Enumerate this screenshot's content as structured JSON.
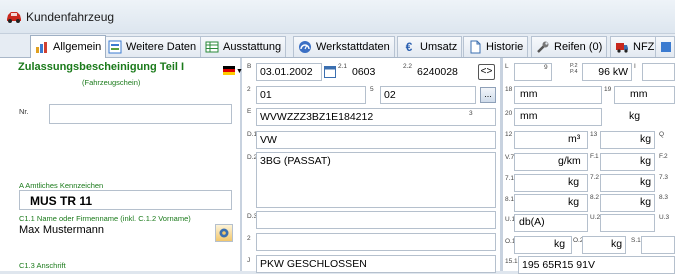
{
  "window": {
    "title": "Kundenfahrzeug"
  },
  "tabs": [
    {
      "label": "Allgemein"
    },
    {
      "label": "Weitere Daten"
    },
    {
      "label": "Ausstattung"
    },
    {
      "label": "Werkstattdaten"
    },
    {
      "label": "Umsatz"
    },
    {
      "label": "Historie"
    },
    {
      "label": "Reifen (0)"
    },
    {
      "label": "NFZ"
    }
  ],
  "left": {
    "heading": "Zulassungsbescheinigung Teil I",
    "subheading": "(Fahrzeugschein)",
    "nr_label": "Nr.",
    "nr_value": "",
    "kennzeichen_label": "A Amtliches Kennzeichen",
    "kennzeichen_value": "MUS TR 11",
    "name_label": "C1.1 Name oder Firmenname (inkl. C.1.2 Vorname)",
    "name_value": "Max Mustermann",
    "anschrift_label": "C1.3 Anschrift"
  },
  "mid": {
    "b_label": "B",
    "b_date": "03.01.2002",
    "code21_label": "2.1",
    "code21": "0603",
    "code22_label": "2.2",
    "code22": "6240028",
    "f2_label": "2",
    "f2_value": "01",
    "f5_label": "5",
    "f5_value": "02",
    "e_label": "E",
    "vin": "WVWZZZ3BZ1E184212",
    "three_label": "3",
    "d1_label": "D.1",
    "d1_value": "VW",
    "d2_label": "D.2",
    "d2_value": "3BG (PASSAT)",
    "d3_label": "D.3",
    "d3_value": "",
    "two_label": "2",
    "two_value": "",
    "j_label": "J",
    "j_value": "PKW GESCHLOSSEN"
  },
  "right": {
    "l_label": "L",
    "nine_label": "9",
    "p2_label": "P.2 P.4",
    "power": "96 kW",
    "i_label": "I",
    "r18_label": "18",
    "r18_unit": "mm",
    "r19_label": "19",
    "r19_unit": "mm",
    "r20_label": "20",
    "r20_unit": "mm",
    "g_label": "G",
    "g_unit": "kg",
    "r12_label": "12",
    "r12_unit": "m³",
    "r13_label": "13",
    "r13_unit": "kg",
    "q_label": "Q",
    "v7_label": "V.7",
    "v7_unit": "g/km",
    "f1_label": "F.1",
    "f1_unit": "kg",
    "f2_label": "F.2",
    "r71_label": "7.1",
    "r71_unit": "kg",
    "r72_label": "7.2",
    "r72_unit": "kg",
    "r73_label": "7.3",
    "r81_label": "8.1",
    "r81_unit": "kg",
    "r82_label": "8.2",
    "r82_unit": "kg",
    "r83_label": "8.3",
    "u1_label": "U.1",
    "u1_unit": "db(A)",
    "u2_label": "U.2",
    "u3_label": "U.3",
    "o1_label": "O.1",
    "o1_unit": "kg",
    "o2_label": "O.2",
    "o2_unit": "kg",
    "s1_label": "S.1",
    "r151_label": "15.1",
    "tire": "195 65R15 91V"
  },
  "colors": {
    "accent_green": "#1a7a1a",
    "tab_border": "#9fb0c4",
    "window_bg": "#dfe6ee"
  }
}
